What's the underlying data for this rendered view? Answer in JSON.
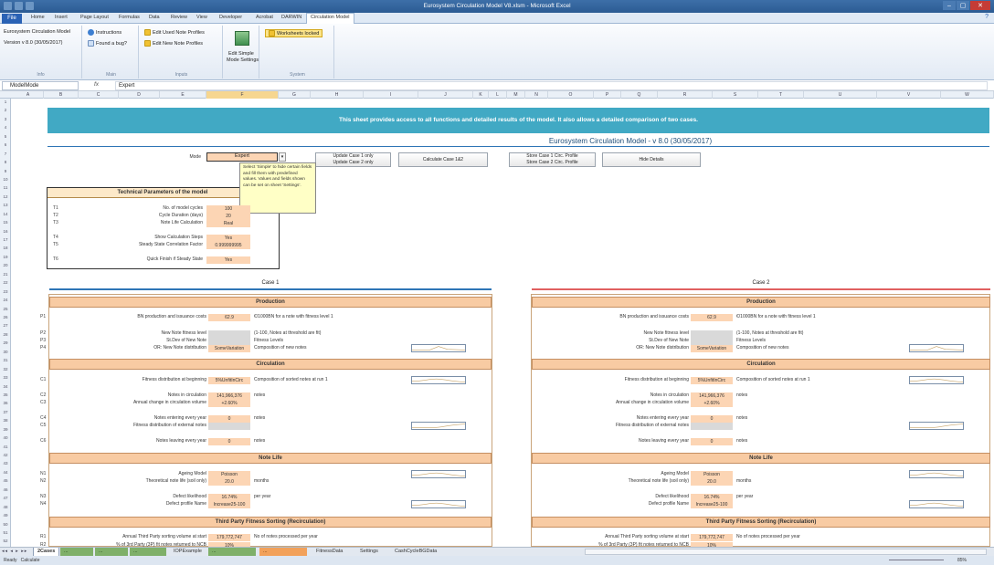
{
  "window": {
    "title": "Eurosystem Circulation Model V8.xlsm - Microsoft Excel",
    "controls": [
      "–",
      "▢",
      "✕"
    ]
  },
  "tabs": {
    "file": "File",
    "items": [
      "Home",
      "Insert",
      "Page Layout",
      "Formulas",
      "Data",
      "Review",
      "View",
      "Developer",
      "Acrobat",
      "DARWIN",
      "Circulation Model"
    ]
  },
  "ribbon": {
    "info": {
      "line1": "Eurosystem Circulation Model",
      "line2": "Version v 8.0 (30/05/2017)",
      "label": "Info"
    },
    "main": {
      "instructions": "Instructions",
      "bug": "Found a bug?",
      "label": "Main"
    },
    "inputs": {
      "used": "Edit Used Note Profiles",
      "new": "Edit New Note Profiles",
      "label": "Inputs"
    },
    "simple": {
      "line1": "Edit Simple",
      "line2": "Mode Settings"
    },
    "system": {
      "locked": "Worksheets locked",
      "label": "System"
    }
  },
  "formula_bar": {
    "name_box": "ModelMode",
    "fx": "fx",
    "value": "Expert"
  },
  "banner": "This sheet provides access to all functions and detailed results of the model. It also allows a detailed comparison of two cases.",
  "model_title": "Eurosystem Circulation Model - v 8.0 (30/05/2017)",
  "mode": {
    "label": "Mode",
    "value": "Expert",
    "arrow": "▾"
  },
  "tooltip": "Select 'Simple' to hide certain fields and fill them with predefined values. Values and fields shown can be set on sheet 'Settings'.",
  "buttons": {
    "update1": "Update Case 1 only",
    "update2": "Update Case 2 only",
    "calc": "Calculate Case 1&2",
    "store1": "Store Case 1 Circ. Profile",
    "store2": "Store Case 2 Circ. Profile",
    "hide": "Hide Details"
  },
  "tech": {
    "title": "Technical Parameters of the model",
    "rows": [
      {
        "code": "T1",
        "label": "No. of model cycles",
        "value": "100"
      },
      {
        "code": "T2",
        "label": "Cycle Duration (days)",
        "value": "20"
      },
      {
        "code": "T3",
        "label": "Note Life Calculation",
        "value": "Real"
      },
      {
        "code": "T4",
        "label": "Show Calculation Steps",
        "value": "Yes"
      },
      {
        "code": "T5",
        "label": "Steady State Correlation Factor",
        "value": "0.999999995"
      },
      {
        "code": "T6",
        "label": "Quick Finish if Steady State",
        "value": "Yes"
      }
    ]
  },
  "case1": {
    "title": "Case 1"
  },
  "case2": {
    "title": "Case 2"
  },
  "sections": {
    "production": "Production",
    "circulation": "Circulation",
    "notelife": "Note Life",
    "thirdparty": "Third Party Fitness Sorting (Recirculation)"
  },
  "rows": {
    "p1": {
      "label": "BN production and issuance costs",
      "value": "62.9",
      "unit": "€/1000BN for a note with fitness level 1"
    },
    "p2": {
      "label": "New Note fitness level",
      "value": "",
      "unit": "(1-100, Notes at threshold are fit)"
    },
    "p3": {
      "label": "St.Dev of New Note",
      "value": "",
      "unit": "Fitness Levels"
    },
    "p4": {
      "label": "OR: New Note distribution",
      "value": "SomeVariation",
      "unit": "Composition of new notes"
    },
    "c1": {
      "label": "Fitness distribution at beginning",
      "value": "5%UnfitInCirc",
      "unit": "Composition of sorted notes at run 1"
    },
    "c2": {
      "label": "Notes in circulation",
      "value": "141,966,376",
      "unit": "notes"
    },
    "c3": {
      "label": "Annual change in circulation volume",
      "value": "+2.60%",
      "unit": ""
    },
    "c4": {
      "label": "Notes entering every year",
      "value": "0",
      "unit": "notes"
    },
    "c5": {
      "label": "Fitness distribution of external notes",
      "value": "",
      "unit": ""
    },
    "c6": {
      "label": "Notes leaving every year",
      "value": "0",
      "unit": "notes"
    },
    "n1": {
      "label": "Ageing Model",
      "value": "Poisson",
      "unit": ""
    },
    "n2": {
      "label": "Theoretical note life (soil only)",
      "value": "20.0",
      "unit": "months"
    },
    "n3": {
      "label": "Defect likelihood",
      "value": "16.74%",
      "unit": "per year"
    },
    "n4": {
      "label": "Defect profile Name",
      "value": "Increase25-100",
      "unit": ""
    },
    "r1": {
      "label": "Annual Third Party sorting volume at start",
      "value": "179,772,747",
      "unit": "No of notes processed per year"
    },
    "r2": {
      "label": "% of 3rd Party (3P) fit notes returned to NCB",
      "value": "10%",
      "unit": ""
    }
  },
  "row_numbers": [
    "1",
    "2",
    "3",
    "4",
    "5",
    "6",
    "7",
    "8",
    "9",
    "10",
    "11",
    "12",
    "13",
    "14",
    "15",
    "16",
    "17",
    "18",
    "19",
    "20",
    "21",
    "22",
    "23",
    "24",
    "25",
    "26",
    "27",
    "28",
    "29",
    "30",
    "31",
    "32",
    "33",
    "34",
    "35",
    "36",
    "37",
    "38",
    "39",
    "40",
    "41",
    "42",
    "43",
    "44",
    "45",
    "46",
    "47",
    "48",
    "49",
    "50",
    "51",
    "52"
  ],
  "columns": [
    "A",
    "B",
    "C",
    "D",
    "E",
    "F",
    "G",
    "H",
    "I",
    "J",
    "K",
    "L",
    "M",
    "N",
    "O",
    "P",
    "Q",
    "R",
    "S",
    "T",
    "U",
    "V",
    "W"
  ],
  "sheet_tabs": [
    "2Cases",
    "...",
    "...",
    "...",
    "IOPExample",
    "...",
    "...",
    "FitnessData",
    "Settings",
    "CashCycleBGData"
  ],
  "status": {
    "ready": "Ready",
    "calculate": "Calculate",
    "zoom": "85%"
  }
}
